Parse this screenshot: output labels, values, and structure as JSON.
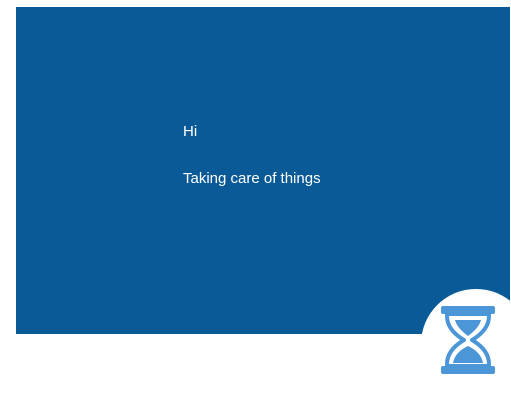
{
  "screen": {
    "background_color": "#0a5a98",
    "greeting": "Hi",
    "status": "Taking care of things"
  },
  "busy_indicator": {
    "icon": "hourglass-icon",
    "color": "#4b96d7"
  }
}
